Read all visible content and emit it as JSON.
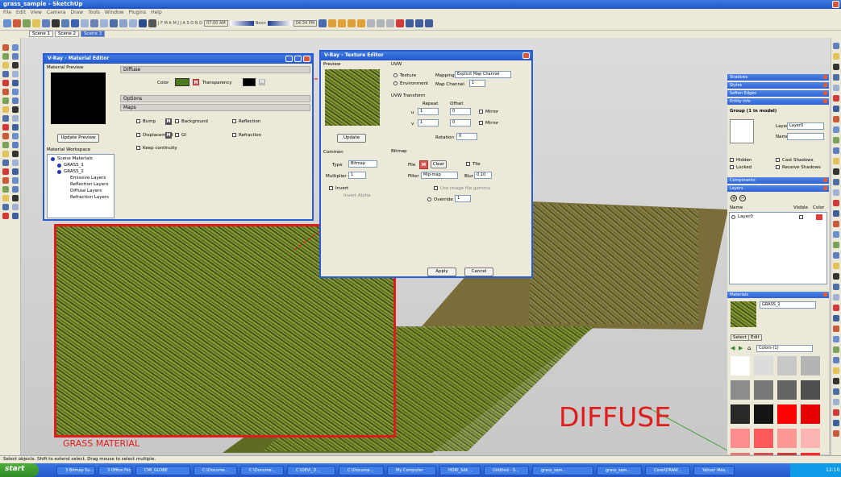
{
  "app": {
    "title": "grass_sample - SketchUp"
  },
  "menu": [
    "File",
    "Edit",
    "View",
    "Camera",
    "Draw",
    "Tools",
    "Window",
    "Plugins",
    "Help"
  ],
  "toolbar": {
    "months": "J F M A M J J A S O N D",
    "time1": "07:00 AM",
    "noon": "Noon",
    "time2": "04:34 PM"
  },
  "scenes": [
    "Scene 1",
    "Scene 2",
    "Scene 3"
  ],
  "material_editor": {
    "title": "V-Ray - Material Editor",
    "material_preview": "Material Preview",
    "diffuse_section": "Diffuse",
    "color_label": "Color",
    "m": "M",
    "transparency_label": "Transparency",
    "options_section": "Options",
    "maps_section": "Maps",
    "bump": "Bump",
    "displacement": "Displacement",
    "keep_continuity": "Keep continuity",
    "background": "Background",
    "gi": "GI",
    "reflection": "Reflection",
    "refraction": "Refraction",
    "update_preview": "Update Preview",
    "material_workspace": "Material Workspace",
    "tree": [
      "Scene Materials",
      "GRASS_1",
      "GRASS_2",
      "Emissive Layers",
      "Reflection Layers",
      "Diffuse Layers",
      "Refraction Layers"
    ]
  },
  "texture_editor": {
    "title": "V-Ray - Texture Editor",
    "preview": "Preview",
    "update": "Update",
    "uvw": "UVW",
    "texture": "Texture",
    "environment": "Environment",
    "mapping_label": "Mapping",
    "mapping_value": "Explicit Map Channel",
    "map_channel_label": "Map Channel",
    "map_channel_value": "1",
    "uvw_transform": "UVW Transform",
    "repeat": "Repeat",
    "offset": "Offset",
    "u": "u",
    "v": "v",
    "u_repeat": "1",
    "u_offset": "0",
    "v_repeat": "1",
    "v_offset": "0",
    "mirror": "Mirror",
    "rotation_label": "Rotation",
    "rotation_value": "0",
    "common": "Common",
    "type_label": "Type",
    "type_value": "Bitmap",
    "multiplier_label": "Multiplier",
    "multiplier_value": "1",
    "invert": "Invert",
    "invert_alpha": "Invert Alpha",
    "bitmap": "Bitmap",
    "file_label": "File",
    "m": "M",
    "clear": "Clear",
    "tile": "Tile",
    "filter_label": "Filter",
    "filter_value": "Mip-map",
    "blur_label": "Blur",
    "blur_value": "0.10",
    "use_image_gamma": "Use image file gamma",
    "override_label": "Override",
    "override_value": "1",
    "apply": "Apply",
    "cancel": "Cancel"
  },
  "tray": {
    "sections": [
      "Shadows",
      "Styles",
      "Soften Edges",
      "Entity Info"
    ],
    "entity_title": "Group (1 in model)",
    "layer_label": "Layer:",
    "layer_value": "Layer0",
    "name_label": "Name:",
    "hidden": "Hidden",
    "locked": "Locked",
    "cast_shadows": "Cast Shadows",
    "receive_shadows": "Receive Shadows",
    "components": "Components",
    "layers": "Layers",
    "col_name": "Name",
    "col_visible": "Visible",
    "col_color": "Color",
    "layer_row": "Layer0",
    "materials": "Materials",
    "material_name": "GRASS_2",
    "select_tab": "Select",
    "edit_tab": "Edit",
    "colors_dropdown": "Colors-(1)",
    "swatches": [
      "#ffffff",
      "#dcdcdc",
      "#c8c8c8",
      "#b4b4b4",
      "#8c8c8c",
      "#787878",
      "#646464",
      "#505050",
      "#282828",
      "#141414",
      "#ff0000",
      "#e60000",
      "#ff8c8c",
      "#ff5a5a",
      "#ff9696",
      "#ffb4b4",
      "#e67878",
      "#d25050",
      "#c83c3c",
      "#ff2828"
    ]
  },
  "labels": {
    "grass_material": "GRASS MATERIAL",
    "diffuse": "DIFFUSE"
  },
  "status": "Select objects. Shift to extend select. Drag mouse to select multiple.",
  "taskbar": {
    "start": "start",
    "tasks": [
      "3 Bitmap Su...",
      "3 Office Fer...",
      "CMI_GLOBE",
      "C:\\Docume...",
      "C:\\Docume...",
      "C:\\DEV\\_D...",
      "C:\\Docume...",
      "My Computer",
      "HDRI_Sdk...",
      "Untitled - S...",
      "grass_sam...",
      "grass_sam...",
      "Corel\\DRAW...",
      "Yahoo! Mes..."
    ],
    "clock": "12:10"
  }
}
